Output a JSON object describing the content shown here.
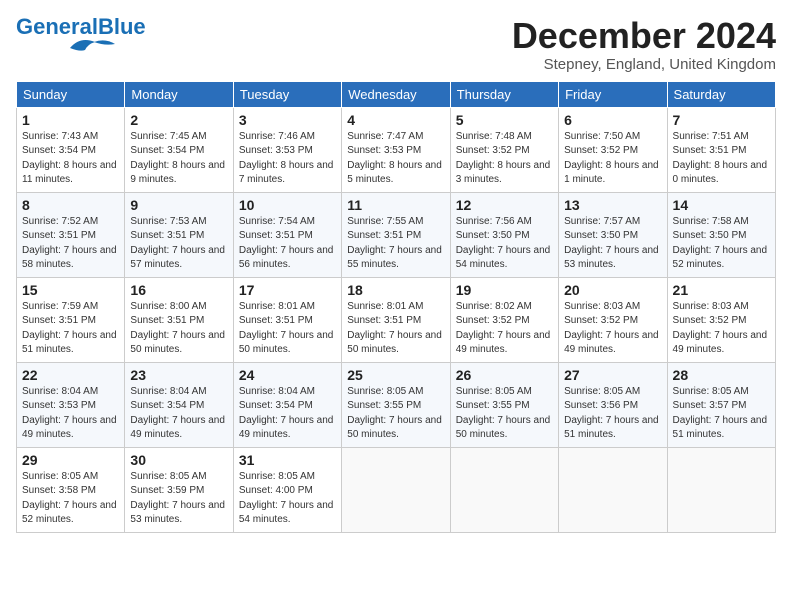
{
  "logo": {
    "general": "General",
    "blue": "Blue"
  },
  "header": {
    "month": "December 2024",
    "location": "Stepney, England, United Kingdom"
  },
  "weekdays": [
    "Sunday",
    "Monday",
    "Tuesday",
    "Wednesday",
    "Thursday",
    "Friday",
    "Saturday"
  ],
  "weeks": [
    [
      {
        "day": "1",
        "rise": "7:43 AM",
        "set": "3:54 PM",
        "daylight": "8 hours and 11 minutes."
      },
      {
        "day": "2",
        "rise": "7:45 AM",
        "set": "3:54 PM",
        "daylight": "8 hours and 9 minutes."
      },
      {
        "day": "3",
        "rise": "7:46 AM",
        "set": "3:53 PM",
        "daylight": "8 hours and 7 minutes."
      },
      {
        "day": "4",
        "rise": "7:47 AM",
        "set": "3:53 PM",
        "daylight": "8 hours and 5 minutes."
      },
      {
        "day": "5",
        "rise": "7:48 AM",
        "set": "3:52 PM",
        "daylight": "8 hours and 3 minutes."
      },
      {
        "day": "6",
        "rise": "7:50 AM",
        "set": "3:52 PM",
        "daylight": "8 hours and 1 minute."
      },
      {
        "day": "7",
        "rise": "7:51 AM",
        "set": "3:51 PM",
        "daylight": "8 hours and 0 minutes."
      }
    ],
    [
      {
        "day": "8",
        "rise": "7:52 AM",
        "set": "3:51 PM",
        "daylight": "7 hours and 58 minutes."
      },
      {
        "day": "9",
        "rise": "7:53 AM",
        "set": "3:51 PM",
        "daylight": "7 hours and 57 minutes."
      },
      {
        "day": "10",
        "rise": "7:54 AM",
        "set": "3:51 PM",
        "daylight": "7 hours and 56 minutes."
      },
      {
        "day": "11",
        "rise": "7:55 AM",
        "set": "3:51 PM",
        "daylight": "7 hours and 55 minutes."
      },
      {
        "day": "12",
        "rise": "7:56 AM",
        "set": "3:50 PM",
        "daylight": "7 hours and 54 minutes."
      },
      {
        "day": "13",
        "rise": "7:57 AM",
        "set": "3:50 PM",
        "daylight": "7 hours and 53 minutes."
      },
      {
        "day": "14",
        "rise": "7:58 AM",
        "set": "3:50 PM",
        "daylight": "7 hours and 52 minutes."
      }
    ],
    [
      {
        "day": "15",
        "rise": "7:59 AM",
        "set": "3:51 PM",
        "daylight": "7 hours and 51 minutes."
      },
      {
        "day": "16",
        "rise": "8:00 AM",
        "set": "3:51 PM",
        "daylight": "7 hours and 50 minutes."
      },
      {
        "day": "17",
        "rise": "8:01 AM",
        "set": "3:51 PM",
        "daylight": "7 hours and 50 minutes."
      },
      {
        "day": "18",
        "rise": "8:01 AM",
        "set": "3:51 PM",
        "daylight": "7 hours and 50 minutes."
      },
      {
        "day": "19",
        "rise": "8:02 AM",
        "set": "3:52 PM",
        "daylight": "7 hours and 49 minutes."
      },
      {
        "day": "20",
        "rise": "8:03 AM",
        "set": "3:52 PM",
        "daylight": "7 hours and 49 minutes."
      },
      {
        "day": "21",
        "rise": "8:03 AM",
        "set": "3:52 PM",
        "daylight": "7 hours and 49 minutes."
      }
    ],
    [
      {
        "day": "22",
        "rise": "8:04 AM",
        "set": "3:53 PM",
        "daylight": "7 hours and 49 minutes."
      },
      {
        "day": "23",
        "rise": "8:04 AM",
        "set": "3:54 PM",
        "daylight": "7 hours and 49 minutes."
      },
      {
        "day": "24",
        "rise": "8:04 AM",
        "set": "3:54 PM",
        "daylight": "7 hours and 49 minutes."
      },
      {
        "day": "25",
        "rise": "8:05 AM",
        "set": "3:55 PM",
        "daylight": "7 hours and 50 minutes."
      },
      {
        "day": "26",
        "rise": "8:05 AM",
        "set": "3:55 PM",
        "daylight": "7 hours and 50 minutes."
      },
      {
        "day": "27",
        "rise": "8:05 AM",
        "set": "3:56 PM",
        "daylight": "7 hours and 51 minutes."
      },
      {
        "day": "28",
        "rise": "8:05 AM",
        "set": "3:57 PM",
        "daylight": "7 hours and 51 minutes."
      }
    ],
    [
      {
        "day": "29",
        "rise": "8:05 AM",
        "set": "3:58 PM",
        "daylight": "7 hours and 52 minutes."
      },
      {
        "day": "30",
        "rise": "8:05 AM",
        "set": "3:59 PM",
        "daylight": "7 hours and 53 minutes."
      },
      {
        "day": "31",
        "rise": "8:05 AM",
        "set": "4:00 PM",
        "daylight": "7 hours and 54 minutes."
      },
      null,
      null,
      null,
      null
    ]
  ]
}
